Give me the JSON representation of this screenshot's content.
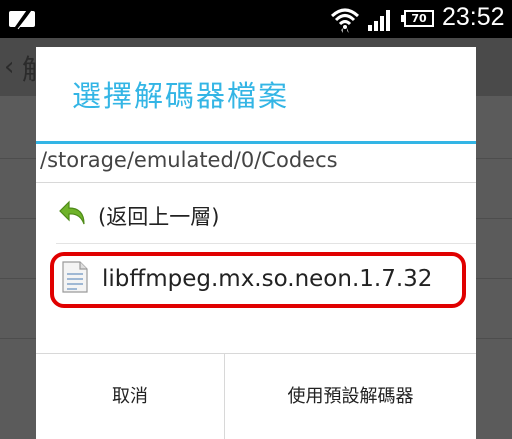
{
  "status_bar": {
    "battery_level": "70",
    "time": "23:52",
    "icons": [
      "battery-saver-icon",
      "wifi-icon",
      "signal-icon",
      "battery-icon"
    ]
  },
  "background_app": {
    "title_fragment": "解"
  },
  "dialog": {
    "title": "選擇解碼器檔案",
    "path": "/storage/emulated/0/Codecs",
    "up_label": "(返回上一層)",
    "files": [
      {
        "name": "libffmpeg.mx.so.neon.1.7.32",
        "icon": "file-icon"
      }
    ],
    "buttons": {
      "cancel": "取消",
      "use_default": "使用預設解碼器"
    }
  },
  "colors": {
    "accent": "#33b5e5",
    "highlight": "#e00000",
    "dim_background": "#555555"
  }
}
